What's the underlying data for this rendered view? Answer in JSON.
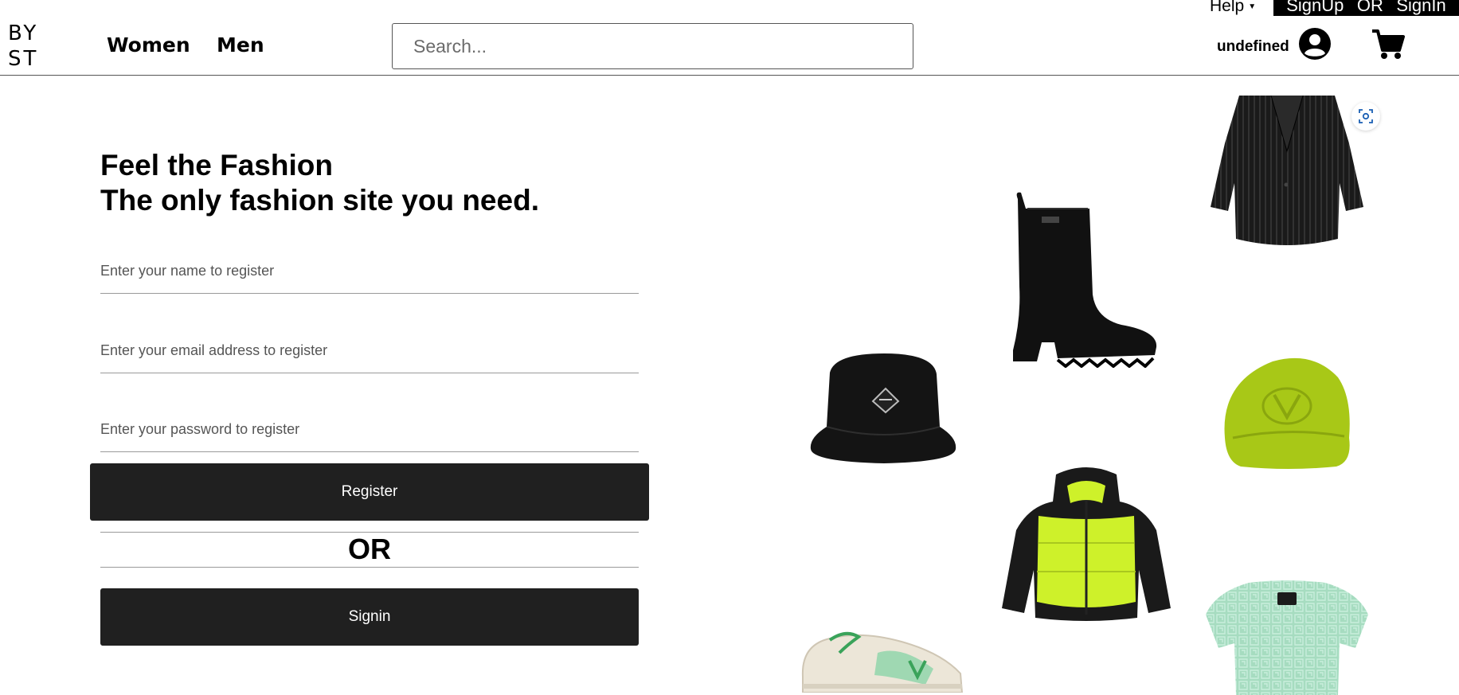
{
  "header": {
    "logo_line1": "BY",
    "logo_line2": "ST",
    "nav": {
      "women": "Women",
      "men": "Men"
    },
    "search_placeholder": "Search...",
    "help_label": "Help",
    "auth": {
      "signup": "SignUp",
      "or": "OR",
      "signin": "SignIn"
    },
    "user_name": "undefined",
    "icons": {
      "user": "user-circle-icon",
      "cart": "cart-icon",
      "caret": "caret-down-icon"
    }
  },
  "main": {
    "hero_line1": "Feel the Fashion",
    "hero_line2": "The only fashion site you need.",
    "form": {
      "name_placeholder": "Enter your name to register",
      "email_placeholder": "Enter your email address to register",
      "password_placeholder": "Enter your password to register",
      "register_label": "Register",
      "or_label": "OR",
      "signin_label": "Signin"
    }
  },
  "gallery": {
    "items": [
      "pinstripe-blazer",
      "black-rain-boot",
      "black-bucket-hat",
      "lime-baseball-cap",
      "lime-puffer-jacket",
      "mint-knit-top",
      "green-sneaker"
    ],
    "scan_icon": "visual-search-icon"
  },
  "colors": {
    "button_bg": "#202020",
    "auth_bar_bg": "#000000",
    "lime": "#a8c817",
    "mint": "#a6dcc0"
  }
}
